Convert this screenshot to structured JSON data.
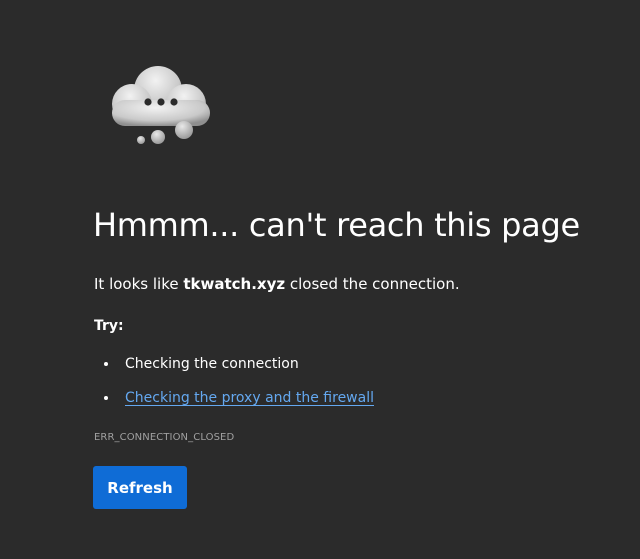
{
  "error_page": {
    "title": "Hmmm... can't reach this page",
    "description_prefix": "It looks like ",
    "domain": "tkwatch.xyz",
    "description_suffix": " closed the connection.",
    "try_label": "Try:",
    "suggestions": [
      {
        "text": "Checking the connection",
        "is_link": false
      },
      {
        "text": "Checking the proxy and the firewall",
        "is_link": true
      }
    ],
    "error_code": "ERR_CONNECTION_CLOSED",
    "refresh_label": "Refresh",
    "icon": "cloud-ellipsis-icon"
  },
  "colors": {
    "background": "#2b2b2b",
    "text": "#ffffff",
    "link": "#64a8f0",
    "error_code_text": "#a0a0a0",
    "button": "#0f6cd6"
  }
}
